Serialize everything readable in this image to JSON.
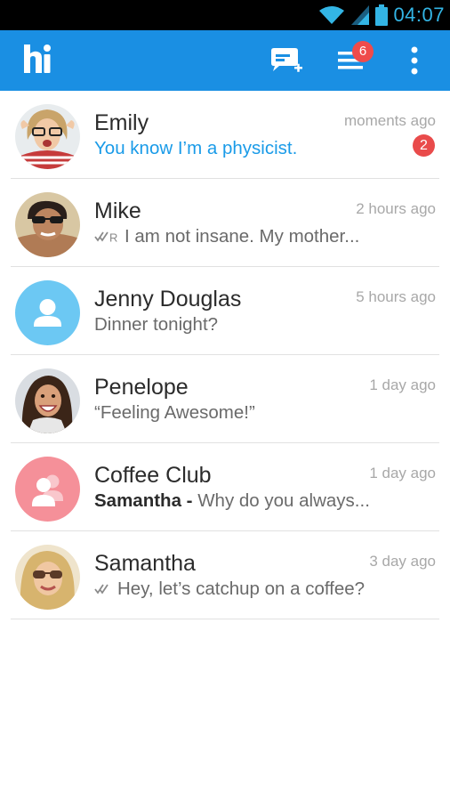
{
  "status_bar": {
    "time": "04:07"
  },
  "app_bar": {
    "logo_text": "hi",
    "menu_badge_count": "6"
  },
  "colors": {
    "app_bar": "#1a8fe3",
    "accent_blue": "#1a9be8",
    "badge_red": "#e94b4b",
    "status_time": "#33b5e5"
  },
  "chats": [
    {
      "name": "Emily",
      "time": "moments ago",
      "preview": "You know I’m a physicist.",
      "unread_count": "2",
      "avatar": "photo-emily"
    },
    {
      "name": "Mike",
      "time": "2 hours ago",
      "preview": "I am not insane. My mother...",
      "status_icon": "double-check-read-icon",
      "status_label": "R",
      "avatar": "photo-mike"
    },
    {
      "name": "Jenny Douglas",
      "time": "5 hours ago",
      "preview": "Dinner tonight?",
      "avatar": "default-user-icon"
    },
    {
      "name": "Penelope",
      "time": "1 day ago",
      "preview": "“Feeling Awesome!”",
      "avatar": "photo-penelope"
    },
    {
      "name": "Coffee Club",
      "time": "1 day ago",
      "sender": "Samantha",
      "separator": " - ",
      "preview": "Why do you always...",
      "avatar": "group-icon"
    },
    {
      "name": "Samantha",
      "time": "3 day ago",
      "preview": "Hey, let’s catchup on a coffee?",
      "status_icon": "double-check-icon",
      "avatar": "photo-samantha"
    }
  ]
}
